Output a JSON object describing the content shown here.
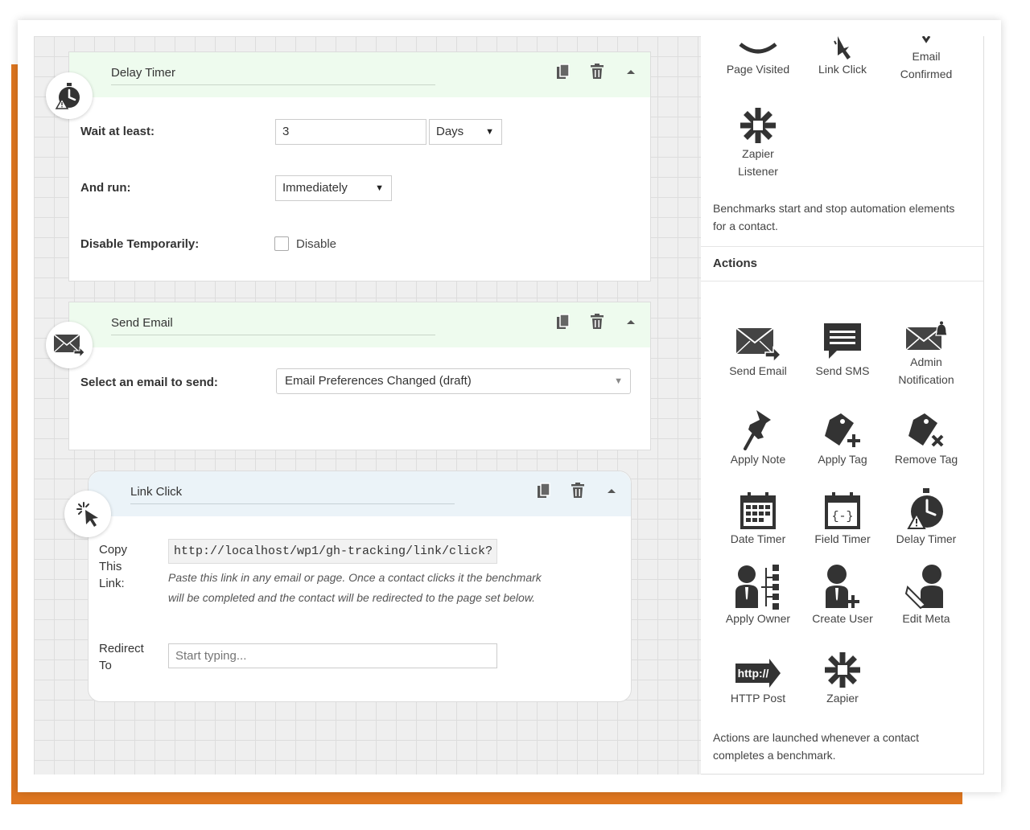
{
  "steps": {
    "delay_timer": {
      "title": "Delay Timer",
      "wait_label": "Wait at least:",
      "wait_value": "3",
      "wait_unit": "Days",
      "run_label": "And run:",
      "run_value": "Immediately",
      "disable_label": "Disable Temporarily:",
      "disable_checkbox_label": "Disable"
    },
    "send_email": {
      "title": "Send Email",
      "select_label": "Select an email to send:",
      "select_value": "Email Preferences Changed (draft)"
    },
    "link_click": {
      "title": "Link Click",
      "copy_label_1": "Copy",
      "copy_label_2": "This",
      "copy_label_3": "Link:",
      "link_value": "http://localhost/wp1/gh-tracking/link/click?",
      "hint_1": "Paste this link in any email or page. Once a contact clicks it the benchmark",
      "hint_2": "will be completed and the contact will be redirected to the page set below.",
      "redirect_label_1": "Redirect",
      "redirect_label_2": "To",
      "redirect_placeholder": "Start typing..."
    }
  },
  "sidebar": {
    "benchmarks": [
      {
        "label": "Page Visited",
        "icon": "page-visited-icon"
      },
      {
        "label": "Link Click",
        "icon": "link-click-icon"
      },
      {
        "label": "Email Confirmed",
        "icon": "email-confirmed-icon"
      },
      {
        "label": "Zapier Listener",
        "icon": "zapier-icon"
      }
    ],
    "benchmarks_text": "Benchmarks start and stop automation elements for a contact.",
    "actions_title": "Actions",
    "actions": [
      {
        "label": "Send Email",
        "icon": "send-email-icon"
      },
      {
        "label": "Send SMS",
        "icon": "send-sms-icon"
      },
      {
        "label": "Admin Notification",
        "icon": "admin-notification-icon"
      },
      {
        "label": "Apply Note",
        "icon": "pin-icon"
      },
      {
        "label": "Apply Tag",
        "icon": "tag-plus-icon"
      },
      {
        "label": "Remove Tag",
        "icon": "tag-remove-icon"
      },
      {
        "label": "Date Timer",
        "icon": "calendar-icon"
      },
      {
        "label": "Field Timer",
        "icon": "field-timer-icon"
      },
      {
        "label": "Delay Timer",
        "icon": "stopwatch-icon"
      },
      {
        "label": "Apply Owner",
        "icon": "apply-owner-icon"
      },
      {
        "label": "Create User",
        "icon": "create-user-icon"
      },
      {
        "label": "Edit Meta",
        "icon": "edit-meta-icon"
      },
      {
        "label": "HTTP Post",
        "icon": "http-post-icon"
      },
      {
        "label": "Zapier",
        "icon": "zapier-icon"
      }
    ],
    "actions_text": "Actions are launched whenever a contact completes a benchmark."
  }
}
